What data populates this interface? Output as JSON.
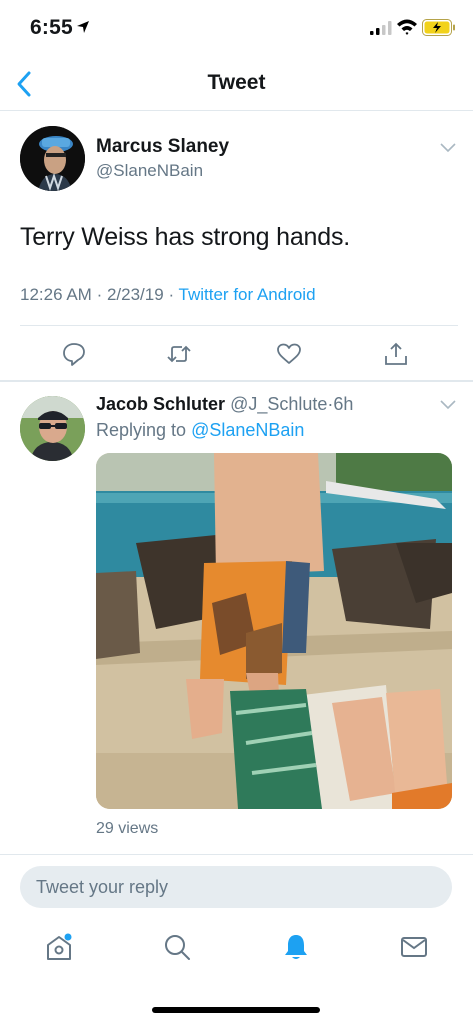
{
  "status_bar": {
    "time": "6:55"
  },
  "nav": {
    "title": "Tweet"
  },
  "tweet": {
    "author_name": "Marcus Slaney",
    "author_handle": "@SlaneNBain",
    "text": "Terry Weiss has strong hands.",
    "time": "12:26 AM",
    "date": "2/23/19",
    "source": "Twitter for Android",
    "separator": "·"
  },
  "reply": {
    "author_name": "Jacob Schluter",
    "author_handle": "@J_Schlute",
    "separator": "·",
    "age": "6h",
    "replying_prefix": "Replying to",
    "replying_to": "@SlaneNBain",
    "views": "29 views"
  },
  "compose": {
    "placeholder": "Tweet your reply"
  },
  "icons": {
    "reply": "reply-icon",
    "retweet": "retweet-icon",
    "like": "heart-icon",
    "share": "share-icon",
    "home": "home-icon",
    "search": "search-icon",
    "notifications": "bell-icon",
    "messages": "mail-icon"
  },
  "colors": {
    "accent": "#1da1f2",
    "secondary_text": "#657786",
    "divider": "#e1e8ed",
    "battery": "#f2d21a"
  }
}
